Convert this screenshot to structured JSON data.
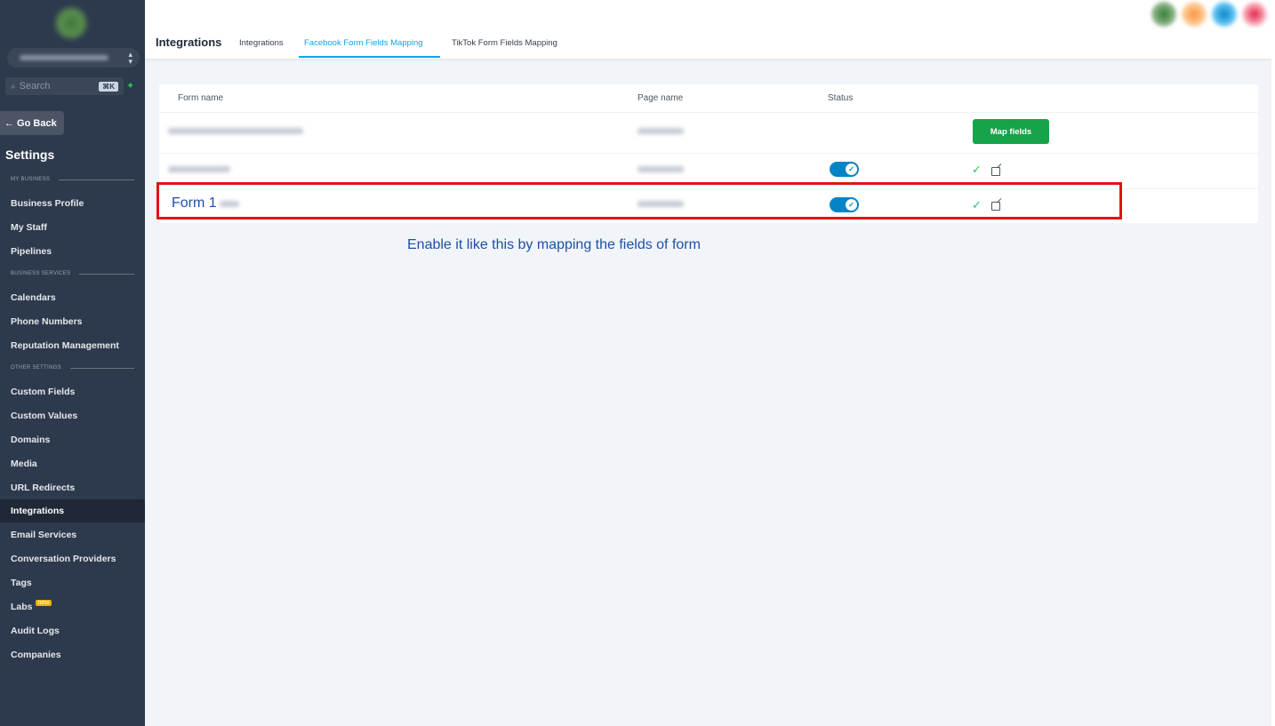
{
  "sidebar": {
    "search_placeholder": "Search",
    "search_shortcut": "⌘K",
    "go_back": "← Go Back",
    "title": "Settings",
    "sections": {
      "my_business": "MY BUSINESS",
      "business_services": "BUSINESS SERVICES",
      "other_settings": "OTHER SETTINGS"
    },
    "items": [
      {
        "label": "Business Profile"
      },
      {
        "label": "My Staff"
      },
      {
        "label": "Pipelines"
      },
      {
        "label": "Calendars"
      },
      {
        "label": "Phone Numbers"
      },
      {
        "label": "Reputation Management"
      },
      {
        "label": "Custom Fields"
      },
      {
        "label": "Custom Values"
      },
      {
        "label": "Domains"
      },
      {
        "label": "Media"
      },
      {
        "label": "URL Redirects"
      },
      {
        "label": "Integrations",
        "active": true
      },
      {
        "label": "Email Services"
      },
      {
        "label": "Conversation Providers"
      },
      {
        "label": "Tags"
      },
      {
        "label": "Labs",
        "badge": "new"
      },
      {
        "label": "Audit Logs"
      },
      {
        "label": "Companies"
      }
    ]
  },
  "header": {
    "title": "Integrations",
    "tabs": [
      {
        "label": "Integrations"
      },
      {
        "label": "Facebook Form Fields Mapping",
        "active": true
      },
      {
        "label": "TikTok Form Fields Mapping"
      }
    ]
  },
  "table": {
    "columns": [
      "Form name",
      "Page name",
      "Status"
    ],
    "rows": [
      {
        "action": "Map fields"
      },
      {
        "status": "enabled"
      },
      {
        "form_name": "Form 1",
        "status": "enabled"
      }
    ]
  },
  "annotation": {
    "text": "Enable it like this by mapping the fields of form",
    "box_color": "#e01414"
  },
  "colors": {
    "sidebar_bg": "#2d3a4d",
    "accent": "#0ea5e9",
    "toggle": "#0284c7",
    "button_green": "#16a34a",
    "annotation_text": "#1e4fa6"
  }
}
